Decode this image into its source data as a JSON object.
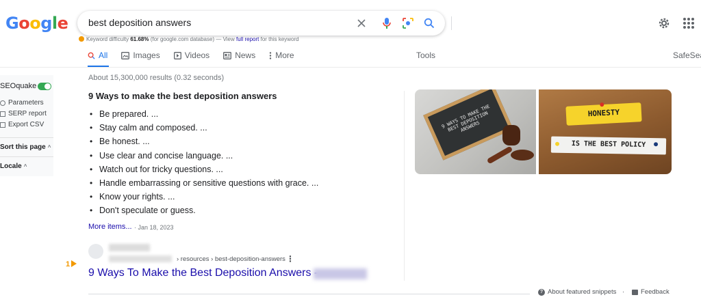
{
  "logo": {
    "letters": [
      "G",
      "o",
      "o",
      "g",
      "l",
      "e"
    ]
  },
  "search": {
    "query": "best deposition answers"
  },
  "keyword_bar": {
    "label": "Keyword difficulty",
    "value": "61.68%",
    "note": "(for google.com database)",
    "dash": "— View",
    "link": "full report",
    "suffix": "for this keyword"
  },
  "tabs": [
    {
      "label": "All",
      "icon": "search-icon",
      "active": true
    },
    {
      "label": "Images",
      "icon": "image-icon"
    },
    {
      "label": "Videos",
      "icon": "video-icon"
    },
    {
      "label": "News",
      "icon": "news-icon"
    },
    {
      "label": "More",
      "icon": "more-vert-icon"
    }
  ],
  "tools_label": "Tools",
  "safesearch_label": "SafeSea",
  "seoquake": {
    "title": "SEOquake",
    "items": [
      "Parameters",
      "SERP report",
      "Export CSV"
    ],
    "sort_label": "Sort this page",
    "locale_label": "Locale"
  },
  "results": {
    "stats": "About 15,300,000 results (0.32 seconds)",
    "snippet": {
      "title": "9 Ways to make the best deposition answers",
      "items": [
        "Be prepared. ...",
        "Stay calm and composed. ...",
        "Be honest. ...",
        "Use clear and concise language. ...",
        "Watch out for tricky questions. ...",
        "Handle embarrassing or sensitive questions with grace. ...",
        "Know your rights. ...",
        "Don't speculate or guess."
      ],
      "more_label": "More items...",
      "date": "· Jan 18, 2023"
    },
    "first_result": {
      "rank": "1",
      "breadcrumb": "› resources › best-deposition-answers",
      "title": "9 Ways To Make the Best Deposition Answers -"
    }
  },
  "images": {
    "chalkboard_text": "9 WAYS TO MAKE THE BEST DEPOSITION ANSWERS",
    "note1": "HONESTY",
    "note2": "IS THE BEST POLICY"
  },
  "footer": {
    "about": "About featured snippets",
    "dot": "·",
    "feedback": "Feedback"
  },
  "colors": {
    "link": "#1a0dab",
    "accent": "#1a73e8",
    "seoquake_toggle": "#34a853",
    "rank_marker": "#f29900"
  }
}
